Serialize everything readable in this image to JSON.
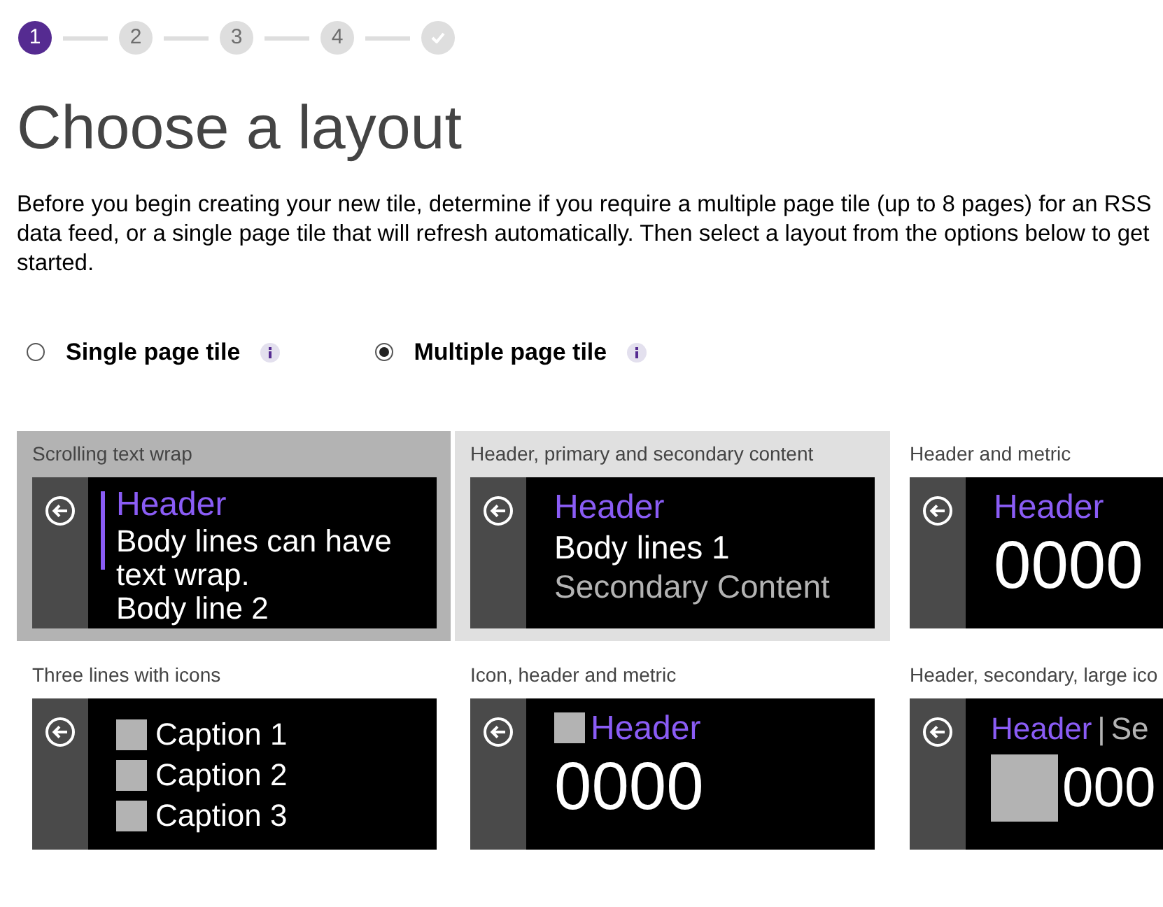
{
  "steps": [
    {
      "kind": "number",
      "label": "1",
      "selected": true
    },
    {
      "kind": "number",
      "label": "2",
      "selected": false
    },
    {
      "kind": "number",
      "label": "3",
      "selected": false
    },
    {
      "kind": "number",
      "label": "4",
      "selected": false
    },
    {
      "kind": "done",
      "selected": false
    }
  ],
  "title": "Choose a layout",
  "intro": "Before you begin creating your new tile, determine if you require a multiple page tile (up to 8 pages) for an RSS data feed, or a single page tile that will refresh automatically. Then select a layout from the options below to get started.",
  "tile_types": [
    {
      "label": "Single page tile",
      "selected": false
    },
    {
      "label": "Multiple page tile",
      "selected": true
    }
  ],
  "layouts": [
    {
      "kind": "text_wrap",
      "label": "Scrolling text wrap",
      "selected": true,
      "hovered": false,
      "header": "Header",
      "lines": [
        "Body lines can have text wrap.",
        "Body line 2"
      ]
    },
    {
      "kind": "header_secondary",
      "label": "Header, primary and secondary content",
      "selected": false,
      "hovered": true,
      "header": "Header",
      "lines": [
        "Body lines 1",
        "Secondary Content"
      ]
    },
    {
      "kind": "header_metric",
      "label": "Header and metric",
      "selected": false,
      "hovered": false,
      "header": "Header",
      "metric": "0000"
    },
    {
      "kind": "captions",
      "label": "Three lines with icons",
      "selected": false,
      "hovered": false,
      "lines": [
        "Caption 1",
        "Caption 2",
        "Caption 3"
      ]
    },
    {
      "kind": "icon_header_metric",
      "label": "Icon, header and metric",
      "selected": false,
      "hovered": false,
      "header": "Header",
      "metric": "0000"
    },
    {
      "kind": "large_icon",
      "label": "Header, secondary, large ico",
      "selected": false,
      "hovered": false,
      "header": "Header",
      "separator": "|",
      "secondary": "Se",
      "metric": "000"
    }
  ]
}
